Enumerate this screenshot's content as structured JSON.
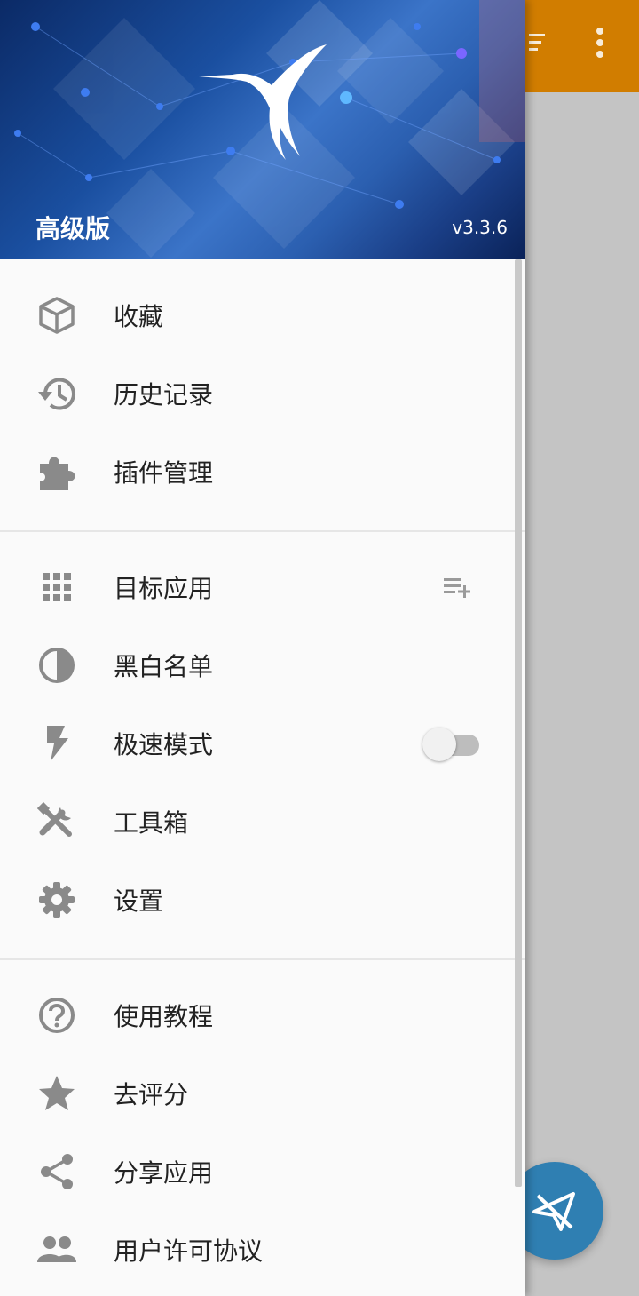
{
  "background": {
    "toolbar_color": "#d17d00",
    "icons": [
      "sort-icon",
      "more-vert-icon"
    ],
    "fab_icon": "paper-plane-off-icon"
  },
  "header": {
    "title": "高级版",
    "version": "v3.3.6"
  },
  "menu": {
    "group1": [
      {
        "label": "收藏",
        "icon": "cube-icon"
      },
      {
        "label": "历史记录",
        "icon": "history-icon"
      },
      {
        "label": "插件管理",
        "icon": "puzzle-icon"
      }
    ],
    "group2": [
      {
        "label": "目标应用",
        "icon": "apps-grid-icon"
      },
      {
        "label": "黑白名单",
        "icon": "half-circle-icon"
      },
      {
        "label": "极速模式",
        "icon": "flash-icon",
        "toggle_on": false
      },
      {
        "label": "工具箱",
        "icon": "tools-icon"
      },
      {
        "label": "设置",
        "icon": "gear-icon"
      }
    ],
    "group3": [
      {
        "label": "使用教程",
        "icon": "help-icon"
      },
      {
        "label": "去评分",
        "icon": "star-icon"
      },
      {
        "label": "分享应用",
        "icon": "share-icon"
      },
      {
        "label": "用户许可协议",
        "icon": "people-icon"
      }
    ]
  }
}
